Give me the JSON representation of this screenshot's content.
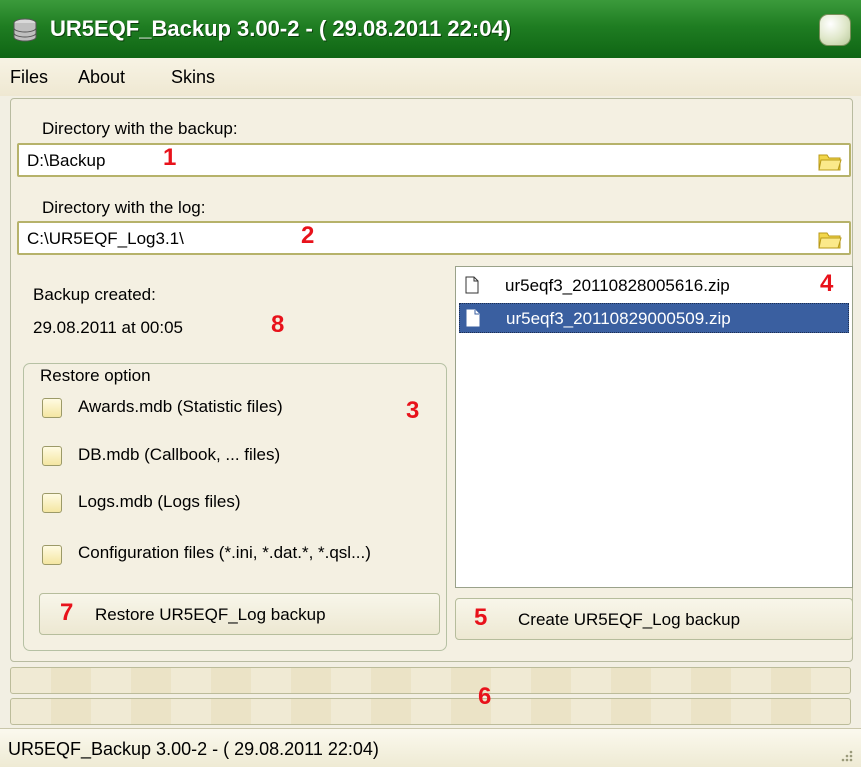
{
  "window": {
    "title": "UR5EQF_Backup 3.00-2 -  ( 29.08.2011 22:04)",
    "icon": "database-icon"
  },
  "menu": {
    "items": [
      "Files",
      "About",
      "Skins"
    ]
  },
  "backup_dir": {
    "label": "Directory with the backup:",
    "value": "D:\\Backup",
    "marker": "1"
  },
  "log_dir": {
    "label": "Directory with the log:",
    "value": "C:\\UR5EQF_Log3.1\\",
    "marker": "2"
  },
  "backup_info": {
    "label": "Backup created:",
    "value": "29.08.2011 at 00:05",
    "marker": "8"
  },
  "restore": {
    "group_label": "Restore option",
    "marker": "3",
    "options": [
      "Awards.mdb  (Statistic files)",
      "DB.mdb (Callbook, ... files)",
      "Logs.mdb (Logs files)",
      "Configuration files (*.ini, *.dat.*, *.qsl...)"
    ],
    "button_label": "Restore UR5EQF_Log backup",
    "button_marker": "7"
  },
  "files": {
    "marker": "4",
    "items": [
      "ur5eqf3_20110828005616.zip",
      "ur5eqf3_20110829000509.zip"
    ],
    "selected_index": 1
  },
  "create": {
    "button_label": "Create UR5EQF_Log backup",
    "marker": "5"
  },
  "progress_marker": "6",
  "status": {
    "text": "UR5EQF_Backup 3.00-2 -  ( 29.08.2011 22:04)"
  },
  "colors": {
    "title_green": "#1f7d22",
    "marker_red": "#e8121b",
    "selection_blue": "#3a5fa0",
    "field_border": "#b6b26a"
  }
}
